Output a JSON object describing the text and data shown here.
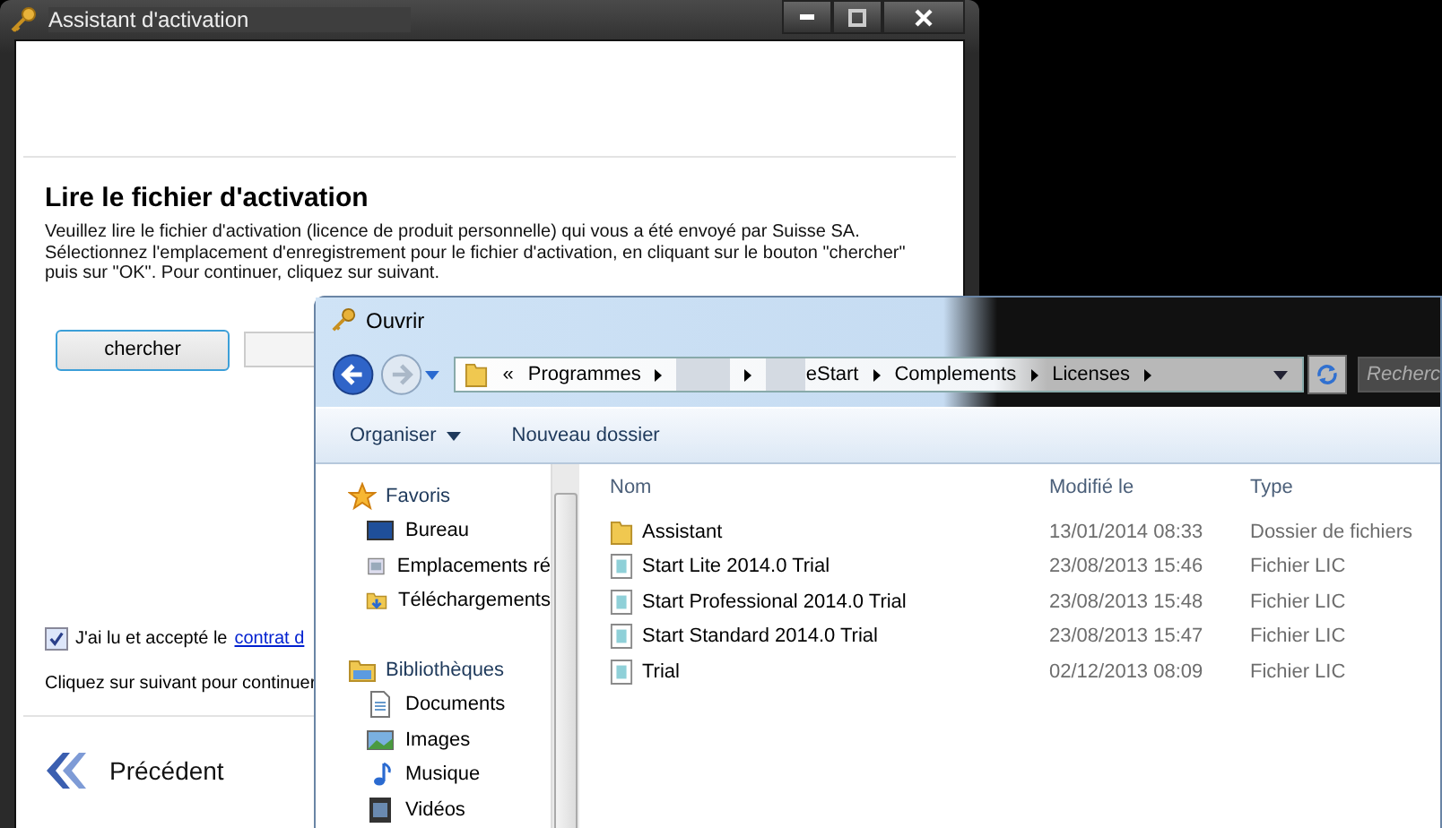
{
  "wizard": {
    "title": "Assistant d'activation",
    "heading": "Lire le fichier d'activation",
    "description": "Veuillez lire le fichier d'activation (licence de produit personnelle) qui vous a été envoyé par Suisse SA.\nSélectionnez l'emplacement d'enregistrement pour le fichier d'activation, en cliquant sur le bouton \"chercher\"\npuis sur \"OK\". Pour continuer, cliquez sur suivant.",
    "browse_button": "chercher",
    "agreement": {
      "checked": true,
      "label": "J'ai lu et accepté le",
      "link": "contrat d"
    },
    "instruction": "Cliquez sur suivant pour continuer",
    "back_button": "Précédent"
  },
  "open_dialog": {
    "title": "Ouvrir",
    "breadcrumb": [
      {
        "kind": "overflow",
        "label": "«"
      },
      {
        "kind": "folder",
        "label": "Programmes"
      },
      {
        "kind": "redacted"
      },
      {
        "kind": "folder",
        "label": "eStart"
      },
      {
        "kind": "folder",
        "label": "Complements"
      },
      {
        "kind": "folder",
        "label": "Licenses"
      }
    ],
    "search": {
      "placeholder": "Recherc"
    },
    "toolbar": [
      {
        "label": "Organiser",
        "has_menu": true
      },
      {
        "label": "Nouveau dossier",
        "has_menu": false
      }
    ],
    "sidebar": [
      {
        "label": "Favoris",
        "children": [
          {
            "label": "Bureau"
          },
          {
            "label": "Emplacements ré"
          },
          {
            "label": "Téléchargements"
          }
        ]
      },
      {
        "label": "Bibliothèques",
        "children": [
          {
            "label": "Documents"
          },
          {
            "label": "Images"
          },
          {
            "label": "Musique"
          },
          {
            "label": "Vidéos"
          }
        ]
      }
    ],
    "columns": [
      "Nom",
      "Modifié le",
      "Type"
    ],
    "files": [
      {
        "kind": "folder",
        "name": "Assistant",
        "modified": "13/01/2014 08:33",
        "type": "Dossier de fichiers"
      },
      {
        "kind": "file",
        "name": "Start Lite 2014.0 Trial",
        "modified": "23/08/2013 15:46",
        "type": "Fichier LIC"
      },
      {
        "kind": "file",
        "name": "Start Professional 2014.0 Trial",
        "modified": "23/08/2013 15:48",
        "type": "Fichier LIC"
      },
      {
        "kind": "file",
        "name": "Start Standard 2014.0 Trial",
        "modified": "23/08/2013 15:47",
        "type": "Fichier LIC"
      },
      {
        "kind": "file",
        "name": "Trial",
        "modified": "02/12/2013 08:09",
        "type": "Fichier LIC"
      }
    ]
  }
}
